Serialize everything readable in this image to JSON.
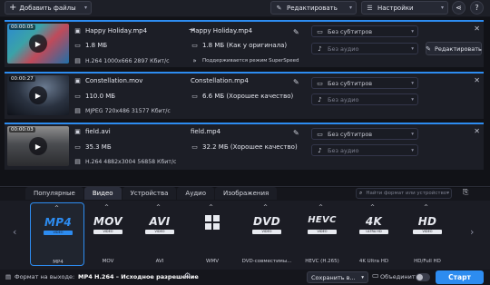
{
  "toolbar": {
    "add_files_label": "Добавить файлы",
    "edit_label": "Редактировать",
    "settings_label": "Настройки"
  },
  "files": [
    {
      "duration": "00:00:05",
      "name": "Happy Holiday.mp4",
      "size": "1.8 МБ",
      "info": "H.264 1000x666 2897 Кбит/с",
      "output_name": "Happy Holiday.mp4",
      "output_size": "1.8 МБ (Как у оригинала)",
      "note": "Поддерживается режим SuperSpeed",
      "subtitles": "Без субтитров",
      "audio": "Без аудио",
      "edit_label": "Редактировать"
    },
    {
      "duration": "00:00:27",
      "name": "Constellation.mov",
      "size": "110.0 МБ",
      "info": "MJPEG 720x486 31577 Кбит/с",
      "output_name": "Constellation.mp4",
      "output_size": "6.6 МБ (Хорошее качество)",
      "subtitles": "Без субтитров",
      "audio": "Без аудио"
    },
    {
      "duration": "00:00:03",
      "name": "field.avi",
      "size": "35.3 МБ",
      "info": "H.264 4882x3004 56858 Кбит/с",
      "output_name": "field.mp4",
      "output_size": "32.2 МБ (Хорошее качество)",
      "subtitles": "Без субтитров",
      "audio": "Без аудио"
    }
  ],
  "tabs": [
    "Популярные",
    "Видео",
    "Устройства",
    "Аудио",
    "Изображения"
  ],
  "active_tab": "Видео",
  "search_placeholder": "Найти формат или устройство",
  "formats": [
    {
      "logo": "MP4",
      "sub": "VIDEO",
      "name": "MP4"
    },
    {
      "logo": "MOV",
      "sub": "VIDEO",
      "name": "MOV"
    },
    {
      "logo": "AVI",
      "sub": "VIDEO",
      "name": "AVI"
    },
    {
      "logo": "",
      "sub": "",
      "name": "WMV"
    },
    {
      "logo": "DVD",
      "sub": "VIDEO",
      "name": "DVD-совместимы..."
    },
    {
      "logo": "HEVC",
      "sub": "VIDEO",
      "name": "HEVC (H.265)"
    },
    {
      "logo": "4K",
      "sub": "ULTRA HD",
      "name": "4K Ultra HD"
    },
    {
      "logo": "HD",
      "sub": "VIDEO",
      "name": "HD/Full HD"
    }
  ],
  "bottom": {
    "output_format_label": "Формат на выходе:",
    "output_format_value": "MP4 H.264 – Исходное разрешение",
    "save_to_label": "Сохранить в...",
    "merge_label": "Объединить:",
    "start_label": "Старт"
  },
  "colors": {
    "accent": "#2d8cf0",
    "background": "#15161c"
  }
}
